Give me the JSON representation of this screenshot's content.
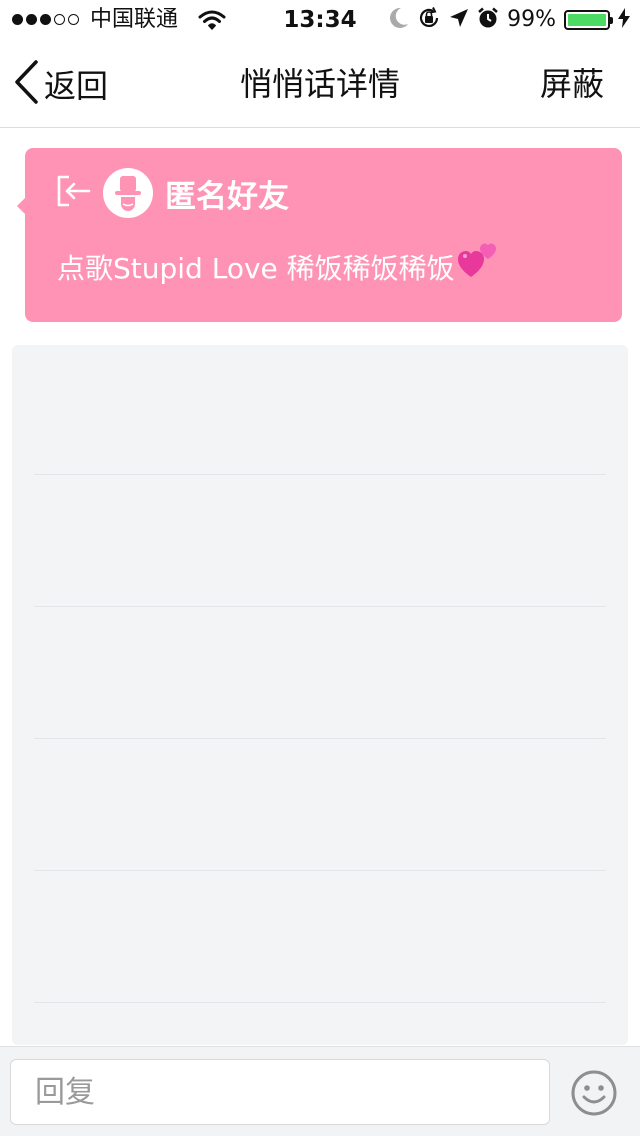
{
  "status_bar": {
    "carrier": "中国联通",
    "time": "13:34",
    "battery_percent": "99%",
    "battery_level": 0.99,
    "signal_filled": 3,
    "signal_total": 5
  },
  "nav": {
    "back_label": "返回",
    "title": "悄悄话详情",
    "block_label": "屏蔽"
  },
  "message": {
    "sender": "匿名好友",
    "text": "点歌Stupid Love 稀饭稀饭稀饭",
    "emoji_icon": "two-hearts-icon",
    "card_color": "#ff93b6"
  },
  "reply": {
    "placeholder": "回复"
  },
  "colors": {
    "accent_pink": "#ff93b6",
    "battery_green": "#4cd964",
    "panel_gray": "#f3f4f5"
  }
}
